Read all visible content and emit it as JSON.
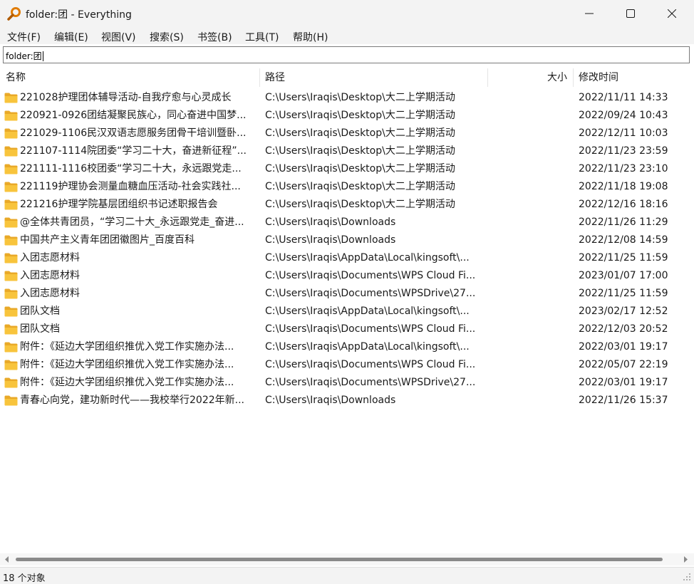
{
  "window": {
    "title": "folder:团 - Everything"
  },
  "menu": [
    "文件(F)",
    "编辑(E)",
    "视图(V)",
    "搜索(S)",
    "书签(B)",
    "工具(T)",
    "帮助(H)"
  ],
  "search": {
    "value": "folder:团"
  },
  "columns": {
    "name": "名称",
    "path": "路径",
    "size": "大小",
    "modified": "修改时间"
  },
  "rows": [
    {
      "name": "221028护理团体辅导活动-自我疗愈与心灵成长",
      "path": "C:\\Users\\Iraqis\\Desktop\\大二上学期活动",
      "size": "",
      "modified": "2022/11/11 14:33"
    },
    {
      "name": "220921-0926团结凝聚民族心，同心奋进中国梦...",
      "path": "C:\\Users\\Iraqis\\Desktop\\大二上学期活动",
      "size": "",
      "modified": "2022/09/24 10:43"
    },
    {
      "name": "221029-1106民汉双语志愿服务团骨干培训暨卧...",
      "path": "C:\\Users\\Iraqis\\Desktop\\大二上学期活动",
      "size": "",
      "modified": "2022/12/11 10:03"
    },
    {
      "name": "221107-1114院团委“学习二十大，奋进新征程”...",
      "path": "C:\\Users\\Iraqis\\Desktop\\大二上学期活动",
      "size": "",
      "modified": "2022/11/23 23:59"
    },
    {
      "name": "221111-1116校团委“学习二十大，永远跟党走...",
      "path": "C:\\Users\\Iraqis\\Desktop\\大二上学期活动",
      "size": "",
      "modified": "2022/11/23 23:10"
    },
    {
      "name": "221119护理协会测量血糖血压活动-社会实践社...",
      "path": "C:\\Users\\Iraqis\\Desktop\\大二上学期活动",
      "size": "",
      "modified": "2022/11/18 19:08"
    },
    {
      "name": "221216护理学院基层团组织书记述职报告会",
      "path": "C:\\Users\\Iraqis\\Desktop\\大二上学期活动",
      "size": "",
      "modified": "2022/12/16 18:16"
    },
    {
      "name": "@全体共青团员，“学习二十大_永远跟党走_奋进...",
      "path": "C:\\Users\\Iraqis\\Downloads",
      "size": "",
      "modified": "2022/11/26 11:29"
    },
    {
      "name": "中国共产主义青年团团徽图片_百度百科",
      "path": "C:\\Users\\Iraqis\\Downloads",
      "size": "",
      "modified": "2022/12/08 14:59"
    },
    {
      "name": "入团志愿材料",
      "path": "C:\\Users\\Iraqis\\AppData\\Local\\kingsoft\\...",
      "size": "",
      "modified": "2022/11/25 11:59"
    },
    {
      "name": "入团志愿材料",
      "path": "C:\\Users\\Iraqis\\Documents\\WPS Cloud Fi...",
      "size": "",
      "modified": "2023/01/07 17:00"
    },
    {
      "name": "入团志愿材料",
      "path": "C:\\Users\\Iraqis\\Documents\\WPSDrive\\27...",
      "size": "",
      "modified": "2022/11/25 11:59"
    },
    {
      "name": "团队文档",
      "path": "C:\\Users\\Iraqis\\AppData\\Local\\kingsoft\\...",
      "size": "",
      "modified": "2023/02/17 12:52"
    },
    {
      "name": "团队文档",
      "path": "C:\\Users\\Iraqis\\Documents\\WPS Cloud Fi...",
      "size": "",
      "modified": "2022/12/03 20:52"
    },
    {
      "name": "附件：《延边大学团组织推优入党工作实施办法...",
      "path": "C:\\Users\\Iraqis\\AppData\\Local\\kingsoft\\...",
      "size": "",
      "modified": "2022/03/01 19:17"
    },
    {
      "name": "附件：《延边大学团组织推优入党工作实施办法...",
      "path": "C:\\Users\\Iraqis\\Documents\\WPS Cloud Fi...",
      "size": "",
      "modified": "2022/05/07 22:19"
    },
    {
      "name": "附件：《延边大学团组织推优入党工作实施办法...",
      "path": "C:\\Users\\Iraqis\\Documents\\WPSDrive\\27...",
      "size": "",
      "modified": "2022/03/01 19:17"
    },
    {
      "name": "青春心向党，建功新时代——我校举行2022年新...",
      "path": "C:\\Users\\Iraqis\\Downloads",
      "size": "",
      "modified": "2022/11/26 15:37"
    }
  ],
  "status": {
    "text": "18 个对象"
  },
  "icons": {
    "app": "magnifier-icon",
    "folder": "folder-icon"
  },
  "colors": {
    "folder_fill": "#f8c43c",
    "folder_tab": "#e9a928",
    "app_icon": "#e07b00"
  }
}
